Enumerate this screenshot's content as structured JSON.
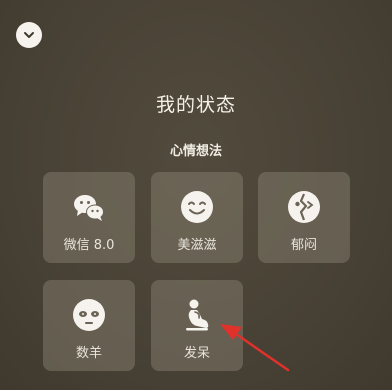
{
  "header": {
    "title": "我的状态",
    "subtitle": "心情想法"
  },
  "status_tiles": [
    {
      "label": "微信 8.0",
      "icon": "wechat-bubbles-icon"
    },
    {
      "label": "美滋滋",
      "icon": "smile-face-icon"
    },
    {
      "label": "郁闷",
      "icon": "broken-heart-icon"
    },
    {
      "label": "数羊",
      "icon": "sheep-face-icon"
    },
    {
      "label": "发呆",
      "icon": "thinker-icon"
    }
  ],
  "annotation": {
    "type": "arrow",
    "color": "#e0322b",
    "points_to": "发呆"
  },
  "colors": {
    "background": "#4a4436",
    "tile": "#7a7264",
    "icon": "#f6f3ee"
  }
}
